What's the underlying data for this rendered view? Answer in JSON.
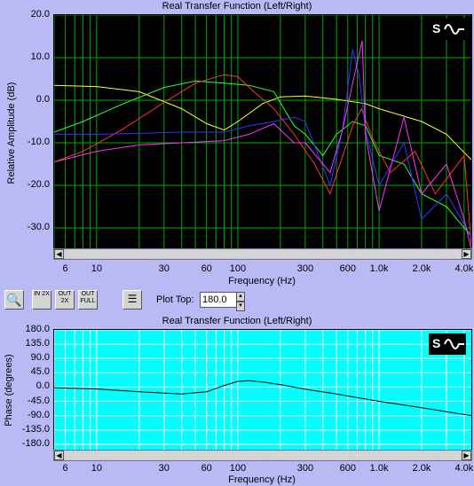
{
  "top_chart": {
    "title": "Real Transfer Function (Left/Right)",
    "ylabel": "Relative Amplitude (dB)",
    "xlabel": "Frequency (Hz)",
    "yticks": [
      "20.0",
      "10.0",
      "0.0",
      "-10.0",
      "-20.0",
      "-30.0"
    ],
    "xticks": [
      "6",
      "10",
      "30",
      "60",
      "100",
      "300",
      "600",
      "1.0k",
      "2.0k",
      "4.0k"
    ]
  },
  "toolbar": {
    "zoom_icon": "magnifier-icon",
    "zoom_in_2x": "IN 2X",
    "zoom_out_2x": "OUT 2X",
    "zoom_out_full": "OUT FULL",
    "plot_top_label": "Plot Top:",
    "plot_top_value": "180.0"
  },
  "bottom_chart": {
    "title": "Real Transfer Function (Left/Right)",
    "ylabel": "Phase (degrees)",
    "xlabel": "Frequency (Hz)",
    "yticks": [
      "180.0",
      "135.0",
      "90.0",
      "45.0",
      "0.0",
      "-45.0",
      "-90.0",
      "-135.0",
      "-180.0"
    ],
    "xticks": [
      "6",
      "10",
      "30",
      "60",
      "100",
      "300",
      "600",
      "1.0k",
      "2.0k",
      "4.0k"
    ]
  },
  "logo_text": "S",
  "chart_data": [
    {
      "type": "line",
      "title": "Real Transfer Function (Left/Right)",
      "xlabel": "Frequency (Hz)",
      "ylabel": "Relative Amplitude (dB)",
      "xscale": "log",
      "xlim": [
        5,
        4500
      ],
      "ylim": [
        -35,
        20
      ],
      "grid": true,
      "background": "#000000",
      "series": [
        {
          "color": "#ffff33",
          "x": [
            5,
            10,
            20,
            40,
            60,
            80,
            100,
            150,
            200,
            300,
            500,
            800,
            1000,
            2000,
            3000,
            4500
          ],
          "y": [
            3.5,
            3.2,
            2,
            -2,
            -5.5,
            -7,
            -5,
            -0.8,
            0.8,
            1,
            0.2,
            -0.8,
            -2,
            -5,
            -8,
            -14
          ]
        },
        {
          "color": "#33ff33",
          "x": [
            5,
            8,
            15,
            30,
            50,
            80,
            120,
            180,
            250,
            300,
            400,
            500,
            650,
            800,
            1000,
            1500,
            2000,
            3000,
            4500
          ],
          "y": [
            -7.5,
            -5,
            -1,
            3,
            4.5,
            4,
            3.5,
            2,
            -6,
            -8,
            -13,
            -8,
            -5,
            -6,
            -13,
            -15,
            -22,
            -25,
            -32
          ]
        },
        {
          "color": "#ff3333",
          "x": [
            5,
            8,
            15,
            30,
            50,
            80,
            100,
            130,
            180,
            250,
            350,
            450,
            650,
            750,
            900,
            1200,
            1800,
            2500,
            4000,
            4500
          ],
          "y": [
            -14.5,
            -12,
            -7,
            -0.5,
            4,
            6,
            5.5,
            2,
            -2,
            -8,
            -15,
            -22,
            -6,
            -2,
            -9,
            -17,
            -12,
            -22,
            -13,
            -34
          ]
        },
        {
          "color": "#3333ff",
          "x": [
            5,
            10,
            20,
            40,
            60,
            80,
            120,
            180,
            250,
            300,
            450,
            550,
            650,
            720,
            800,
            1000,
            1500,
            2000,
            3000,
            4500
          ],
          "y": [
            -8,
            -8,
            -7.8,
            -7.5,
            -7.5,
            -7.5,
            -6,
            -5,
            -4,
            -5,
            -20,
            -7,
            12,
            6,
            -7,
            -20,
            -10,
            -28,
            -22,
            -32
          ]
        },
        {
          "color": "#ff33ff",
          "x": [
            5,
            10,
            20,
            40,
            80,
            120,
            180,
            250,
            300,
            450,
            550,
            650,
            760,
            800,
            1000,
            1500,
            2000,
            3000,
            4000,
            4500
          ],
          "y": [
            -14.5,
            -12,
            -10.5,
            -10,
            -9.5,
            -8,
            -5.5,
            -10,
            -10,
            -17,
            -7,
            4,
            14,
            -8,
            -26,
            -4,
            -22,
            -15,
            -28,
            -35
          ]
        }
      ]
    },
    {
      "type": "line",
      "title": "Real Transfer Function (Left/Right)",
      "xlabel": "Frequency (Hz)",
      "ylabel": "Phase (degrees)",
      "xscale": "log",
      "xlim": [
        5,
        4500
      ],
      "ylim": [
        -200,
        180
      ],
      "grid": true,
      "background": "#00ffff",
      "series": [
        {
          "color": "#000000",
          "x": [
            5,
            10,
            20,
            40,
            60,
            80,
            100,
            120,
            150,
            200,
            300,
            500,
            1000,
            2000,
            4500
          ],
          "y": [
            -2,
            -6,
            -15,
            -22,
            -15,
            5,
            18,
            20,
            16,
            8,
            -7,
            -22,
            -45,
            -65,
            -90
          ]
        }
      ]
    }
  ]
}
